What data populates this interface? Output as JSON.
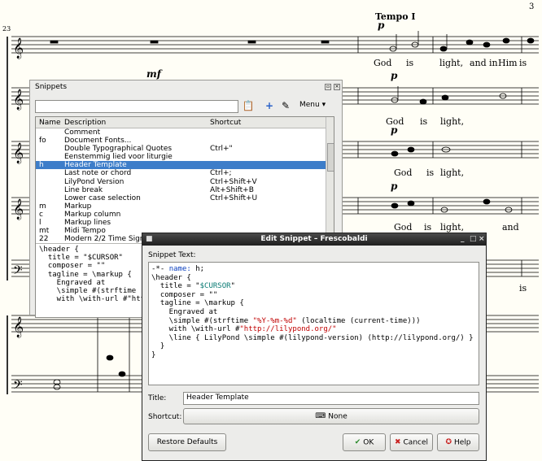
{
  "score": {
    "page_number": "3",
    "bar_number": "23",
    "tempo": "Tempo I",
    "dynamics": [
      "p",
      "p",
      "p",
      "p",
      "mf"
    ],
    "lyric_lines": [
      [
        "God",
        "is",
        "light,",
        "and",
        "in",
        "Him",
        "is"
      ],
      [
        "God",
        "is",
        "light,"
      ],
      [
        "God",
        "is",
        "light,"
      ],
      [
        "God",
        "is",
        "light,",
        "and"
      ],
      [
        "is"
      ]
    ]
  },
  "snippets_panel": {
    "title": "Snippets",
    "search_value": "",
    "menu_label": "Menu",
    "columns": [
      "Name",
      "Description",
      "Shortcut"
    ],
    "rows": [
      {
        "name": "",
        "description": "Comment",
        "shortcut": ""
      },
      {
        "name": "fo",
        "description": "Document Fonts...",
        "shortcut": ""
      },
      {
        "name": "",
        "description": "Double Typographical Quotes",
        "shortcut": "Ctrl+\""
      },
      {
        "name": "",
        "description": "Eenstemmig lied voor liturgie",
        "shortcut": ""
      },
      {
        "name": "h",
        "description": "Header Template",
        "shortcut": ""
      },
      {
        "name": "",
        "description": "Last note or chord",
        "shortcut": "Ctrl+;"
      },
      {
        "name": "",
        "description": "LilyPond Version",
        "shortcut": "Ctrl+Shift+V"
      },
      {
        "name": "",
        "description": "Line break",
        "shortcut": "Alt+Shift+B"
      },
      {
        "name": "",
        "description": "Lower case selection",
        "shortcut": "Ctrl+Shift+U"
      },
      {
        "name": "m",
        "description": "Markup",
        "shortcut": ""
      },
      {
        "name": "c",
        "description": "Markup column",
        "shortcut": ""
      },
      {
        "name": "l",
        "description": "Markup lines",
        "shortcut": ""
      },
      {
        "name": "mt",
        "description": "Midi Tempo",
        "shortcut": ""
      },
      {
        "name": "22",
        "description": "Modern 2/2 Time Signa",
        "shortcut": ""
      }
    ],
    "selected_index": 4,
    "preview_lines": [
      "\\header {",
      "  title = \"$CURSOR\"",
      "  composer = \"\"",
      "  tagline = \\markup {",
      "    Engraved at",
      "    \\simple #(strftime \"",
      "    with \\with-url #\"http"
    ]
  },
  "dialog": {
    "title": "Edit Snippet – Frescobaldi",
    "snippet_text_label": "Snippet Text:",
    "title_label": "Title:",
    "title_value": "Header Template",
    "shortcut_label": "Shortcut:",
    "shortcut_value": "None",
    "restore_defaults": "Restore Defaults",
    "ok": "OK",
    "cancel": "Cancel",
    "help": "Help",
    "code": {
      "line1_prefix": "-*- ",
      "line1_kw": "name:",
      "line1_val": " h;",
      "line2": "\\header {",
      "line3_a": "  title = \"",
      "line3_var": "$CURSOR",
      "line3_b": "\"",
      "line4": "  composer = \"\"",
      "line5": "  tagline = \\markup {",
      "line6": "    Engraved at",
      "line7_a": "    \\simple #(strftime ",
      "line7_str": "\"%Y-%m-%d\"",
      "line7_b": " (localtime (current-time)))",
      "line8_a": "    with \\with-url #",
      "line8_str": "\"http://lilypond.org/\"",
      "line9": "    \\line { LilyPond \\simple #(lilypond-version) (http://lilypond.org/) }",
      "line10": "  }",
      "line11": "}"
    }
  }
}
